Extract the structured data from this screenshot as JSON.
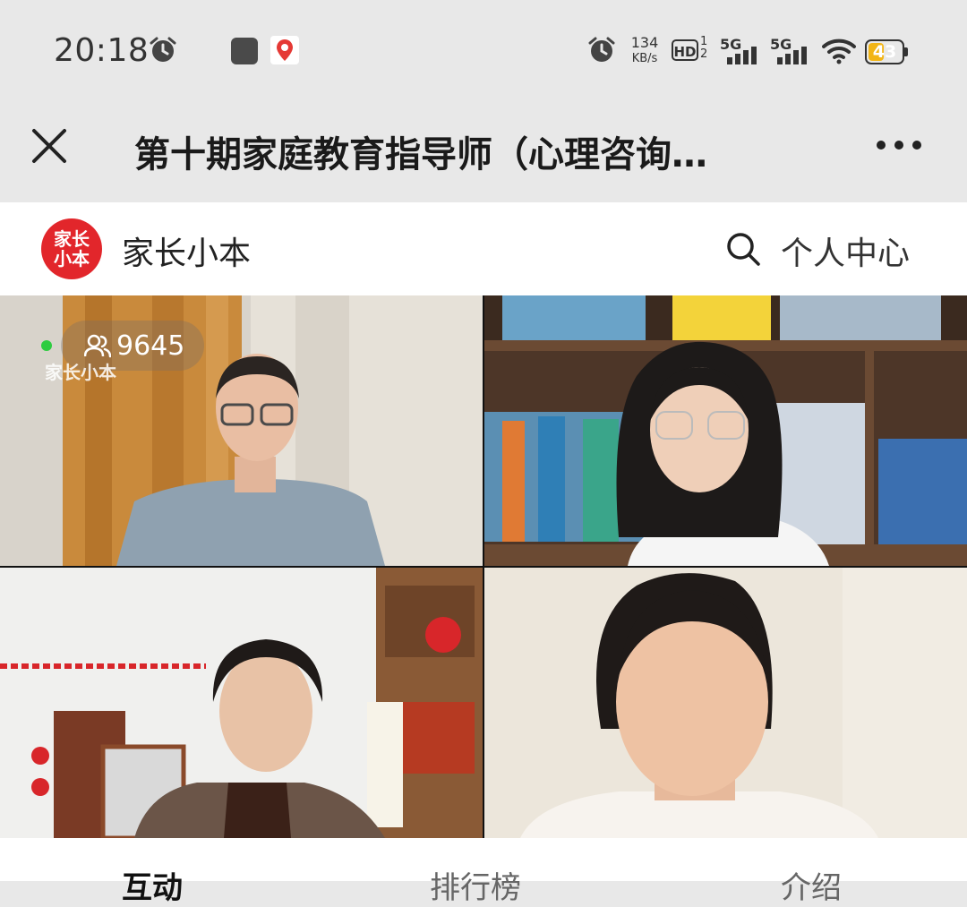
{
  "status_bar": {
    "time": "20:18",
    "net_speed_value": "134",
    "net_speed_unit": "KB/s",
    "hd_label": "HD",
    "hd_sub1": "1",
    "hd_sub2": "2",
    "sim1_label": "5G",
    "sim2_label": "5G",
    "battery_level": "43",
    "battery_fraction": 0.43,
    "battery_color": "#f2b515",
    "icons": [
      "alarm-icon",
      "app-notification-icon",
      "map-icon",
      "alarm-icon",
      "signal-icon",
      "wifi-icon",
      "battery-icon"
    ]
  },
  "title_bar": {
    "title": "第十期家庭教育指导师（心理咨询…",
    "close_icon": "close-icon",
    "more_icon": "more-icon"
  },
  "brand": {
    "logo_line1": "家长",
    "logo_line2": "小本",
    "logo_color": "#e2262b",
    "name": "家长小本",
    "search_icon": "search-icon",
    "personal_center": "个人中心"
  },
  "live": {
    "viewer_count": "9645",
    "viewer_icon": "people-icon",
    "watermark": "家长小本",
    "live_status_color": "#2ecc40"
  },
  "tabs": [
    {
      "label": "互动",
      "active": true
    },
    {
      "label": "排行榜",
      "active": false
    },
    {
      "label": "介绍",
      "active": false
    }
  ]
}
